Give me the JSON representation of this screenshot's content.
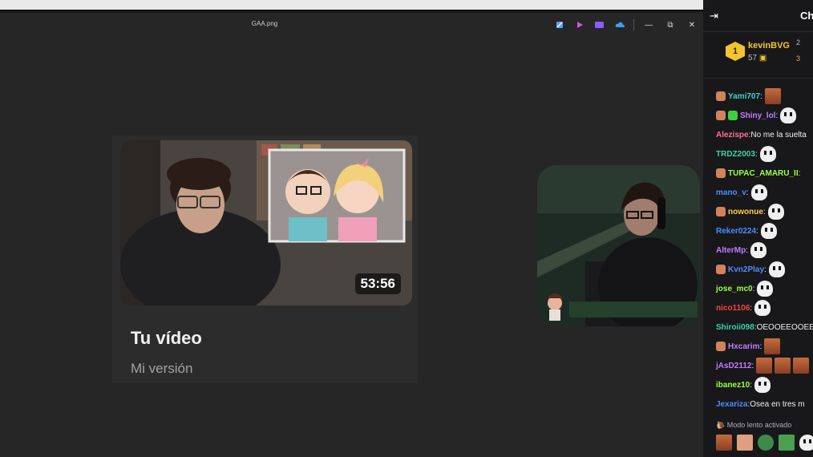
{
  "window": {
    "title": "GAA.png",
    "toolbar_icons": [
      "pen-icon",
      "copilot-icon",
      "effects-icon",
      "onedrive-icon"
    ],
    "controls": [
      "minimize",
      "restore",
      "close"
    ],
    "control_glyphs": {
      "minimize": "—",
      "restore": "⧉",
      "close": "✕"
    }
  },
  "video_card": {
    "title": "Tu vídeo",
    "subtitle": "Mi versión",
    "duration": "53:56"
  },
  "chat": {
    "collapse_glyph": "⇥",
    "title": "Ch",
    "leaderboard": {
      "first": {
        "rank": "1",
        "name": "kevinBVG",
        "points": "57"
      },
      "ranks": [
        "2",
        "3"
      ]
    },
    "messages": [
      {
        "user": "Yami707",
        "color": "#3fd0c9",
        "badge": "#d2835c",
        "text": "",
        "emotes": [
          "face"
        ]
      },
      {
        "user": "Shiny_lol",
        "color": "#c27cff",
        "badge": "#d2835c",
        "badge2": "#3ecf3e",
        "text": "",
        "emotes": [
          "ghost"
        ]
      },
      {
        "user": "Alezispe",
        "color": "#ff6f91",
        "text": " No me la suelta",
        "emotes": []
      },
      {
        "user": "TRDZ2003",
        "color": "#3fd0a4",
        "text": "",
        "emotes": [
          "ghost"
        ]
      },
      {
        "user": "TUPAC_AMARU_II",
        "color": "#9bff4a",
        "badge": "#d2835c",
        "text": "",
        "emotes": []
      },
      {
        "user": "mano_v",
        "color": "#4d8bff",
        "text": "",
        "emotes": [
          "ghost"
        ]
      },
      {
        "user": "nowonue",
        "color": "#ffcf40",
        "badge": "#d2835c",
        "text": "",
        "emotes": [
          "ghost"
        ]
      },
      {
        "user": "Reker0224",
        "color": "#4d8bff",
        "text": "",
        "emotes": [
          "ghost"
        ]
      },
      {
        "user": "AlterMp",
        "color": "#c27cff",
        "text": "",
        "emotes": [
          "ghost"
        ]
      },
      {
        "user": "Kvn2Play",
        "color": "#4d8bff",
        "badge": "#d2835c",
        "text": "",
        "emotes": [
          "ghost"
        ]
      },
      {
        "user": "jose_mc0",
        "color": "#9bff4a",
        "text": "",
        "emotes": [
          "ghost"
        ]
      },
      {
        "user": "nico1106",
        "color": "#ff4040",
        "text": "",
        "emotes": [
          "ghost"
        ]
      },
      {
        "user": "Shiroii098",
        "color": "#3fd0a4",
        "text": " OEOOEEOOEE",
        "emotes": []
      },
      {
        "user": "Hxcarim",
        "color": "#c27cff",
        "badge": "#d2835c",
        "text": "",
        "emotes": [
          "face"
        ]
      },
      {
        "user": "jAsD2112",
        "color": "#c27cff",
        "text": "",
        "emotes": [
          "face",
          "face",
          "face"
        ]
      },
      {
        "user": "ibanez10",
        "color": "#9bff4a",
        "text": "",
        "emotes": [
          "ghost"
        ]
      },
      {
        "user": "Jexariza",
        "color": "#4d8bff",
        "text": " Osea en tres m",
        "emotes": []
      }
    ],
    "slow_mode": "Modo lento activado",
    "slow_icon": "snail-icon"
  },
  "colors": {
    "background": "#262626",
    "chat_bg": "#18181b",
    "rank_gold": "#f4c430"
  }
}
